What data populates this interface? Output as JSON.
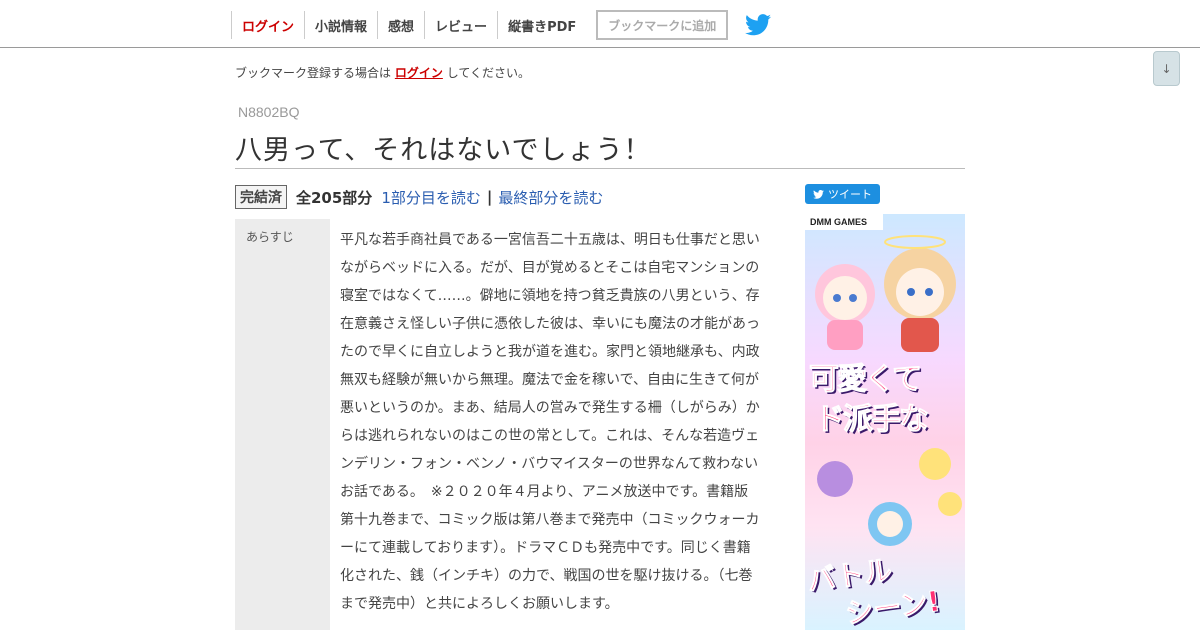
{
  "nav": {
    "items": [
      {
        "label": "ログイン"
      },
      {
        "label": "小説情報"
      },
      {
        "label": "感想"
      },
      {
        "label": "レビュー"
      },
      {
        "label": "縦書きPDF"
      }
    ],
    "bookmark_button": "ブックマークに追加",
    "twitter_icon": "twitter-bird-icon",
    "colors": {
      "login": "#cc0000",
      "twitter": "#1da1f2"
    }
  },
  "scroll_button": {
    "label": "↓"
  },
  "notice": {
    "before": "ブックマーク登録する場合は",
    "link": "ログイン",
    "after": "してください。"
  },
  "novel": {
    "ncode": "N8802BQ",
    "title": "八男って、それはないでしょう！",
    "status_badge": "完結済",
    "total_parts": "全205部分",
    "read_first": "1部分目を読む",
    "separator": "|",
    "read_last": "最終部分を読む",
    "synopsis_label": "あらすじ",
    "synopsis": "平凡な若手商社員である一宮信吾二十五歳は、明日も仕事だと思いながらベッドに入る。だが、目が覚めるとそこは自宅マンションの寝室ではなくて……。僻地に領地を持つ貧乏貴族の八男という、存在意義さえ怪しい子供に憑依した彼は、幸いにも魔法の才能があったので早くに自立しようと我が道を進む。家門と領地継承も、内政無双も経験が無いから無理。魔法で金を稼いで、自由に生きて何が悪いというのか。まあ、結局人の営みで発生する柵（しがらみ）からは逃れられないのはこの世の常として。これは、そんな若造ヴェンデリン・フォン・ベンノ・バウマイスターの世界なんて救わないお話である。　※２０２０年４月より、アニメ放送中です。書籍版第十九巻まで、コミック版は第八巻まで発売中（コミックウォーカーにて連載しております）。ドラマＣＤも発売中です。同じく書籍化された、銭（インチキ）の力で、戦国の世を駆け抜ける。（七巻まで発売中）と共によろしくお願いします。"
  },
  "tweet_button": {
    "label": "ツイート"
  },
  "ad": {
    "brand": "DMM GAMES",
    "line1": "可愛くて",
    "line2": "ド派手な",
    "line3": "バトル",
    "line4": "シーン!"
  }
}
